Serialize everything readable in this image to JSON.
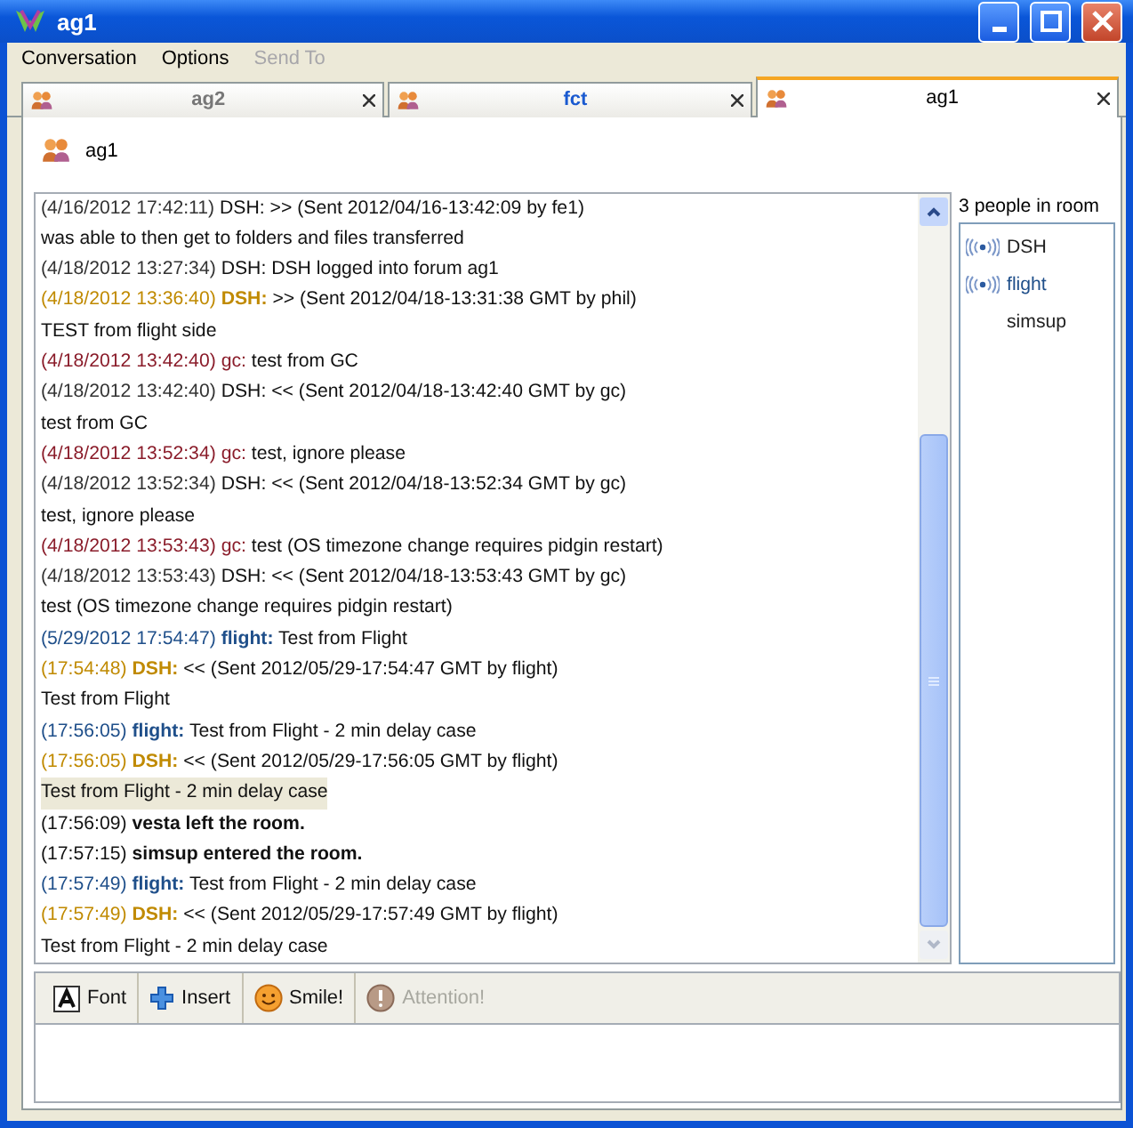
{
  "window": {
    "title": "ag1"
  },
  "menu": [
    {
      "label": "Conversation",
      "disabled": false
    },
    {
      "label": "Options",
      "disabled": false
    },
    {
      "label": "Send To",
      "disabled": true
    }
  ],
  "tabs": [
    {
      "label": "ag2",
      "selected": false,
      "unread": false
    },
    {
      "label": "fct",
      "selected": false,
      "unread": true
    },
    {
      "label": "ag1",
      "selected": true,
      "unread": false
    }
  ],
  "conversation": {
    "title": "ag1"
  },
  "log": [
    {
      "kind": "message",
      "time": "(4/16/2012 17:42:11)",
      "sender": "DSH:",
      "text": ">> (Sent 2012/04/16-13:42:09 by fe1)",
      "color": "#333333",
      "bold": false
    },
    {
      "kind": "body",
      "text": "was able to then get to folders and files transferred",
      "selected": false
    },
    {
      "kind": "message",
      "time": "(4/18/2012 13:27:34)",
      "sender": "DSH:",
      "text": "DSH logged into forum ag1",
      "color": "#333333",
      "bold": false
    },
    {
      "kind": "message",
      "time": "(4/18/2012 13:36:40)",
      "sender": "DSH:",
      "text": ">> (Sent 2012/04/18-13:31:38 GMT by phil)",
      "color": "#c08a00",
      "bold": true
    },
    {
      "kind": "body",
      "text": "TEST from flight side",
      "selected": false
    },
    {
      "kind": "message",
      "time": "(4/18/2012 13:42:40)",
      "sender": "gc:",
      "text": "test from GC",
      "color": "#8a1c2a",
      "bold": false
    },
    {
      "kind": "message",
      "time": "(4/18/2012 13:42:40)",
      "sender": "DSH:",
      "text": "<< (Sent 2012/04/18-13:42:40 GMT by gc)",
      "color": "#333333",
      "bold": false
    },
    {
      "kind": "body",
      "text": "test from GC",
      "selected": false
    },
    {
      "kind": "message",
      "time": "(4/18/2012 13:52:34)",
      "sender": "gc:",
      "text": "test, ignore please",
      "color": "#8a1c2a",
      "bold": false
    },
    {
      "kind": "message",
      "time": "(4/18/2012 13:52:34)",
      "sender": "DSH:",
      "text": "<< (Sent 2012/04/18-13:52:34 GMT by gc)",
      "color": "#333333",
      "bold": false
    },
    {
      "kind": "body",
      "text": "test, ignore please",
      "selected": false
    },
    {
      "kind": "message",
      "time": "(4/18/2012 13:53:43)",
      "sender": "gc:",
      "text": "test (OS timezone change requires pidgin restart)",
      "color": "#8a1c2a",
      "bold": false
    },
    {
      "kind": "message",
      "time": "(4/18/2012 13:53:43)",
      "sender": "DSH:",
      "text": "<< (Sent 2012/04/18-13:53:43 GMT by gc)",
      "color": "#333333",
      "bold": false
    },
    {
      "kind": "body",
      "text": "test (OS timezone change requires pidgin restart)",
      "selected": false
    },
    {
      "kind": "message",
      "time": "(5/29/2012 17:54:47)",
      "sender": "flight:",
      "text": "Test from Flight",
      "color": "#1f4f8a",
      "bold": true
    },
    {
      "kind": "message",
      "time": "(17:54:48)",
      "sender": "DSH:",
      "text": "<< (Sent 2012/05/29-17:54:47 GMT by flight)",
      "color": "#c08a00",
      "bold": true
    },
    {
      "kind": "body",
      "text": "Test from Flight",
      "selected": false
    },
    {
      "kind": "message",
      "time": "(17:56:05)",
      "sender": "flight:",
      "text": "Test from Flight - 2 min delay case",
      "color": "#1f4f8a",
      "bold": true
    },
    {
      "kind": "message",
      "time": "(17:56:05)",
      "sender": "DSH:",
      "text": "<< (Sent 2012/05/29-17:56:05 GMT by flight)",
      "color": "#c08a00",
      "bold": true
    },
    {
      "kind": "body",
      "text": "Test from Flight - 2 min delay case",
      "selected": true
    },
    {
      "kind": "system",
      "time": "(17:56:09)",
      "text": "vesta left the room."
    },
    {
      "kind": "system",
      "time": "(17:57:15)",
      "text": "simsup entered the room."
    },
    {
      "kind": "message",
      "time": "(17:57:49)",
      "sender": "flight:",
      "text": "Test from Flight - 2 min delay case",
      "color": "#1f4f8a",
      "bold": true
    },
    {
      "kind": "message",
      "time": "(17:57:49)",
      "sender": "DSH:",
      "text": "<< (Sent 2012/05/29-17:57:49 GMT by flight)",
      "color": "#c08a00",
      "bold": true
    },
    {
      "kind": "body",
      "text": "Test from Flight - 2 min delay case",
      "selected": false
    }
  ],
  "people": {
    "count": "3 people in room",
    "users": [
      {
        "name": "DSH",
        "voice": true,
        "color": "#222222"
      },
      {
        "name": "flight",
        "voice": true,
        "color": "#1f4f8a"
      },
      {
        "name": "simsup",
        "voice": false,
        "color": "#222222"
      }
    ]
  },
  "toolbar": [
    {
      "kind": "font",
      "label": "Font",
      "disabled": false
    },
    {
      "kind": "insert",
      "label": "Insert",
      "disabled": false
    },
    {
      "kind": "smile",
      "label": "Smile!",
      "disabled": false
    },
    {
      "kind": "attention",
      "label": "Attention!",
      "disabled": true
    }
  ]
}
